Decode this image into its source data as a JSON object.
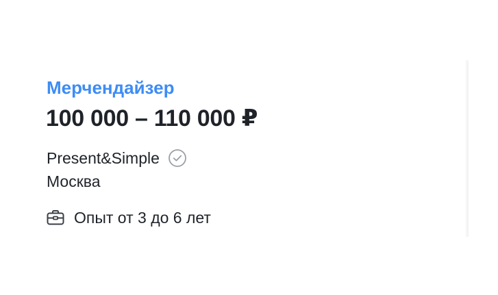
{
  "vacancy": {
    "title": "Мерчендайзер",
    "salary": "100 000 – 110 000 ₽",
    "company": "Present&Simple",
    "company_verified_icon": "verified-check-icon",
    "city": "Москва",
    "experience_icon": "briefcase-icon",
    "experience": "Опыт от 3 до 6 лет"
  },
  "colors": {
    "title": "#3d8cf5",
    "text": "#1f2329",
    "icon": "#5f6368",
    "verified_icon": "#9aa0a6"
  }
}
